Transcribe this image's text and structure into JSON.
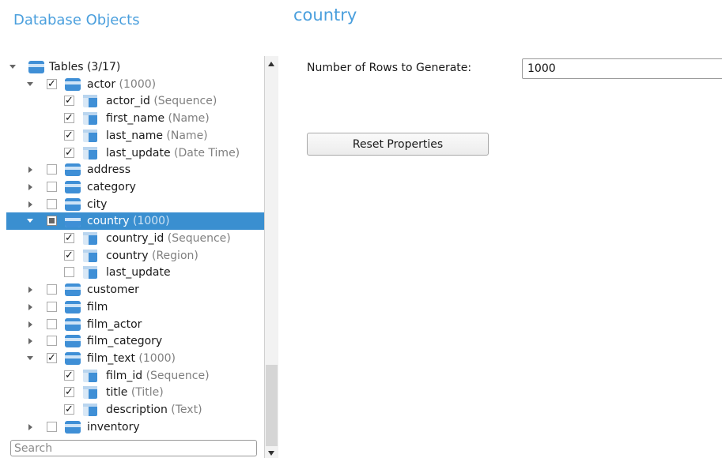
{
  "left_title": "Database Objects",
  "right_title": "country",
  "tree": {
    "root": {
      "label": "Tables (3/17)",
      "expanded": true
    },
    "rows": [
      {
        "kind": "table",
        "name": "actor",
        "meta": "(1000)",
        "expanded": true,
        "check": "checked"
      },
      {
        "kind": "column",
        "name": "actor_id",
        "meta": "(Sequence)",
        "check": "checked"
      },
      {
        "kind": "column",
        "name": "first_name",
        "meta": "(Name)",
        "check": "checked"
      },
      {
        "kind": "column",
        "name": "last_name",
        "meta": "(Name)",
        "check": "checked"
      },
      {
        "kind": "column",
        "name": "last_update",
        "meta": "(Date Time)",
        "check": "checked"
      },
      {
        "kind": "table",
        "name": "address",
        "meta": "",
        "expanded": false,
        "check": "unchecked"
      },
      {
        "kind": "table",
        "name": "category",
        "meta": "",
        "expanded": false,
        "check": "unchecked"
      },
      {
        "kind": "table",
        "name": "city",
        "meta": "",
        "expanded": false,
        "check": "unchecked"
      },
      {
        "kind": "table",
        "name": "country",
        "meta": "(1000)",
        "expanded": true,
        "check": "partial",
        "selected": true
      },
      {
        "kind": "column",
        "name": "country_id",
        "meta": "(Sequence)",
        "check": "checked"
      },
      {
        "kind": "column",
        "name": "country",
        "meta": "(Region)",
        "check": "checked"
      },
      {
        "kind": "column",
        "name": "last_update",
        "meta": "",
        "check": "unchecked"
      },
      {
        "kind": "table",
        "name": "customer",
        "meta": "",
        "expanded": false,
        "check": "unchecked"
      },
      {
        "kind": "table",
        "name": "film",
        "meta": "",
        "expanded": false,
        "check": "unchecked"
      },
      {
        "kind": "table",
        "name": "film_actor",
        "meta": "",
        "expanded": false,
        "check": "unchecked"
      },
      {
        "kind": "table",
        "name": "film_category",
        "meta": "",
        "expanded": false,
        "check": "unchecked"
      },
      {
        "kind": "table",
        "name": "film_text",
        "meta": "(1000)",
        "expanded": true,
        "check": "checked"
      },
      {
        "kind": "column",
        "name": "film_id",
        "meta": "(Sequence)",
        "check": "checked"
      },
      {
        "kind": "column",
        "name": "title",
        "meta": "(Title)",
        "check": "checked"
      },
      {
        "kind": "column",
        "name": "description",
        "meta": "(Text)",
        "check": "checked"
      },
      {
        "kind": "table",
        "name": "inventory",
        "meta": "",
        "expanded": false,
        "check": "unchecked"
      }
    ]
  },
  "search": {
    "placeholder": "Search",
    "value": ""
  },
  "properties": {
    "rows_label": "Number of Rows to Generate:",
    "rows_value": "1000",
    "reset_label": "Reset Properties"
  },
  "colors": {
    "accent": "#4a9fdd",
    "selection": "#3a8fd0"
  }
}
